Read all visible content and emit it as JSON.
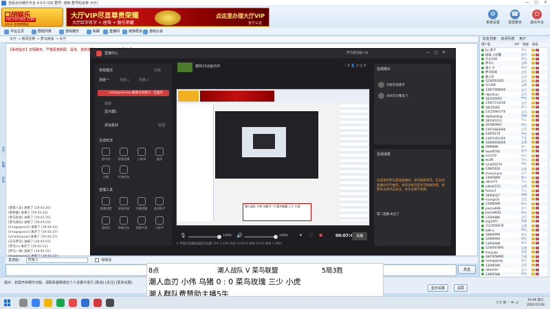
{
  "window": {
    "title": "全民派对娱乐平台 4.0.5 (QQ 群号: 通知 群号码名称 大厅)",
    "controls": [
      "—",
      "□",
      "✕"
    ]
  },
  "header": {
    "logo_main": "口胡娱乐",
    "logo_url": "HD.FXT365.COM",
    "logo_slogan": "2013 有你更精彩",
    "banner_title": "大厅VIP尽显尊贵荣耀",
    "banner_sub": "大厅红字名字 + 座驾 + 靓号荣耀",
    "banner_cta": "点这里办理大厅VIP",
    "banner_cta_sub": "官方认证",
    "top_icons": [
      {
        "label": "系统设置",
        "icon": "gear-icon"
      },
      {
        "label": "语音聊天",
        "icon": "chat-icon"
      },
      {
        "label": "退出平台",
        "icon": "exit-icon"
      }
    ]
  },
  "toolbar": {
    "items": [
      "平台主页",
      "群组列表",
      "游戏娱乐",
      "私聊",
      "直播间",
      "家族帮派",
      "游戏公会"
    ]
  },
  "breadcrumb": "大厅 → 房间名称  → 梦马房会  → 大厅",
  "chat": {
    "notice": "【系统提示】文明聊天，严禁恶意刷屏、辱骂、发布违规信息，违者将被封号处理！",
    "logs": [
      "[游客人员] 进来了 [19:43:20]",
      "[昵称鹿] 进来了 [19:43:34]",
      "[梦马房会] 进来了 [19:43:35]",
      "[梦马阳光] 进来了 [19:44:03]",
      "[Imagegone2] 进来了 [19:44:33]",
      "[Imagegone2] 离开了 [19:44:37]",
      "[xmadaopuw] 进来了 [19:44:37]",
      "[天天梦马] 进来了 [19:45:03]",
      "[梦马rx] 离开了 [19:45:13]",
      "[梦马一样] 进来了 [19:45:31]",
      "[Imagegone2] 进来了 [19:45:33]",
      "[梦马好梦] 离开了 [19:45:36]"
    ],
    "target_label": "发送给：",
    "target_value": "所有人",
    "checkbox_label": "悄悄话",
    "send_label": "发送"
  },
  "sidetabs": [
    "大厅",
    "私聊",
    "好友"
  ],
  "bottom": {
    "ticker": "提示：如需开启娱乐功能，请联系客服或在个人设置中进行 [取消] [关注] [更多设置]",
    "btn_settings": "显示设置",
    "btn_clear": "清屏"
  },
  "rightpanel": {
    "tabs": [
      "好友列表",
      "房间列表",
      "用户"
    ],
    "headers": [
      "用户名",
      "VIP",
      "等级",
      "排名"
    ],
    "users": [
      {
        "name": "Jiy_影子",
        "vip": "",
        "rank": "大二"
      },
      {
        "name": "姚清_小初蕾",
        "vip": "",
        "rank": "大六"
      },
      {
        "name": "百丈元翔",
        "vip": "",
        "rank": "大九"
      },
      {
        "name": "梦马人",
        "vip": "",
        "rank": "上四"
      },
      {
        "name": "唐小 丹",
        "vip": "",
        "rank": "中六"
      },
      {
        "name": "梦马佳成",
        "vip": "",
        "rank": "上七"
      },
      {
        "name": "鹿之灵",
        "vip": "",
        "rank": "上七"
      },
      {
        "name": "1234563302",
        "vip": "",
        "rank": "上九"
      },
      {
        "name": "乐1108",
        "vip": "",
        "rank": "上四"
      },
      {
        "name": "13817008004",
        "vip": "",
        "rank": "上八"
      },
      {
        "name": "nbpofuas",
        "vip": "",
        "rank": "上三"
      },
      {
        "name": "183140092",
        "vip": "",
        "rank": "中七"
      },
      {
        "name": "13927214100",
        "vip": "",
        "rank": "上三"
      },
      {
        "name": "18155001",
        "vip": "",
        "rank": "大一"
      },
      {
        "name": "13125964770",
        "vip": "",
        "rank": "上九"
      },
      {
        "name": "nbjfeoklong",
        "vip": "",
        "rank": "大四"
      },
      {
        "name": "180163311",
        "vip": "",
        "rank": "下二"
      },
      {
        "name": "207800907",
        "vip": "",
        "rank": "中九"
      },
      {
        "name": "13972683646",
        "vip": "",
        "rank": "上三"
      },
      {
        "name": "14055170",
        "vip": "",
        "rank": "中七"
      },
      {
        "name": "13874401205",
        "vip": "",
        "rank": "下三"
      },
      {
        "name": "10800656049",
        "vip": "",
        "rank": "上五"
      },
      {
        "name": "2888888",
        "vip": "",
        "rank": "大一"
      },
      {
        "name": "heart0761",
        "vip": "",
        "rank": "大六"
      },
      {
        "name": "iss2210",
        "vip": "",
        "rank": "中二"
      },
      {
        "name": "wu36",
        "vip": "",
        "rank": "下八"
      },
      {
        "name": "123456579",
        "vip": "",
        "rank": "中七"
      },
      {
        "name": "13845610",
        "vip": "",
        "rank": "上五"
      },
      {
        "name": "chenyii-pun",
        "vip": "",
        "rank": "上二"
      },
      {
        "name": "13045890",
        "vip": "",
        "rank": "中八"
      },
      {
        "name": "nbhei73",
        "vip": "",
        "rank": "下八"
      },
      {
        "name": "sdfsd1573",
        "vip": "",
        "rank": "上五"
      },
      {
        "name": "fuzjou3",
        "vip": "",
        "rank": "下八"
      },
      {
        "name": "18956327",
        "vip": "",
        "rank": "中四"
      },
      {
        "name": "huangli31",
        "vip": "",
        "rank": "上三"
      },
      {
        "name": "13596590",
        "vip": "",
        "rank": "中二"
      },
      {
        "name": "jianhai999",
        "vip": "",
        "rank": "上八"
      },
      {
        "name": "jiacha9031",
        "vip": "",
        "rank": "中七"
      },
      {
        "name": "13594886",
        "vip": "",
        "rank": "上七"
      },
      {
        "name": "mzj1977",
        "vip": "",
        "rank": "大五"
      },
      {
        "name": "1123456078",
        "vip": "",
        "rank": "上五"
      },
      {
        "name": "lolili-u",
        "vip": "",
        "rank": "中九"
      },
      {
        "name": "18800999",
        "vip": "",
        "rank": "大三"
      },
      {
        "name": "12060040",
        "vip": "",
        "rank": "中七"
      },
      {
        "name": "13856908",
        "vip": "",
        "rank": "中二"
      },
      {
        "name": "1234567891",
        "vip": "",
        "rank": "上五"
      },
      {
        "name": "lhoujuqu",
        "vip": "",
        "rank": "大五"
      },
      {
        "name": "1867658985",
        "vip": "",
        "rank": "下五"
      },
      {
        "name": "huangqiang",
        "vip": "",
        "rank": "大二"
      },
      {
        "name": "13596590",
        "vip": "",
        "rank": "上七"
      },
      {
        "name": "nbweiiao",
        "vip": "",
        "rank": "上八"
      },
      {
        "name": "13895588",
        "vip": "",
        "rank": "中三"
      }
    ]
  },
  "obs": {
    "title": "直播中心",
    "subtitle": "关闭",
    "user": "梦马服务器人员",
    "left": {
      "mode_label": "常规模式",
      "mode_action": "切换",
      "scenes": [
        "场景一",
        "场景二",
        "场景三"
      ],
      "active_source": "rockspeed.exe 截取文本窗口 - 已显示",
      "cam_label": "画面",
      "show_label": "显示器1",
      "add_source": "添加素材",
      "add_source_right": "管理",
      "interactive": "互动玩法",
      "tools_row1": [
        "画中画",
        "视频直播",
        "小剧场",
        "抽奖"
      ],
      "tools_row2": [
        "点歌",
        "礼物任务"
      ],
      "live_tools": "直播工具",
      "tools_row3": [
        "直播设置",
        "虚拟形象",
        "开播提醒",
        "游戏助手"
      ],
      "tools_row4": [
        "管理员",
        "高级任务",
        "观看大屏",
        "小助手"
      ]
    },
    "stream": {
      "name": "德风23点赴约中",
      "stats": "♡ 0   👤 2   ◷ 0"
    },
    "preview_caption": "潮人战队 小伟 乌猪 0 : 0 菜鸟联盟 三少 小虎",
    "controls": {
      "mic_pct": "100%",
      "speaker_pct": "100%",
      "time": "00:07:42",
      "stop": "关播"
    },
    "footer": "⊙ 不提示直播画面提示设置     CPU 3.15%   内存 14.91%   帧率 59.95   速率 1.2M/s",
    "online": {
      "title": "在线观众",
      "users": [
        "白银无情素字",
        "尚尚无尽覆盖飞"
      ]
    },
    "msgs": {
      "title": "互动消息",
      "welcome": "欢迎来到梦马游戏直播间，请勿刷屏辱骂，在任何直播间均不推荐，发布违规内容有可能被封禁，如需关注请点击关注，关注主播不迷路。",
      "tag": "第二直播 关注了"
    }
  },
  "overlay": {
    "line1_a": "8点",
    "line1_b": "潮人战队 V 菜鸟联盟",
    "line1_c": "5局3胜",
    "line2": "潮人血刃 小伟  乌猪  0 :  0 菜鸟玫瑰 三少 小虎",
    "line3": "潮人群队费赞助主播5牛"
  },
  "taskbar": {
    "tray_text": "5°C 阴  ⌃  中  ◁)",
    "time": "19:46 周三",
    "date": "2022/12/28"
  }
}
